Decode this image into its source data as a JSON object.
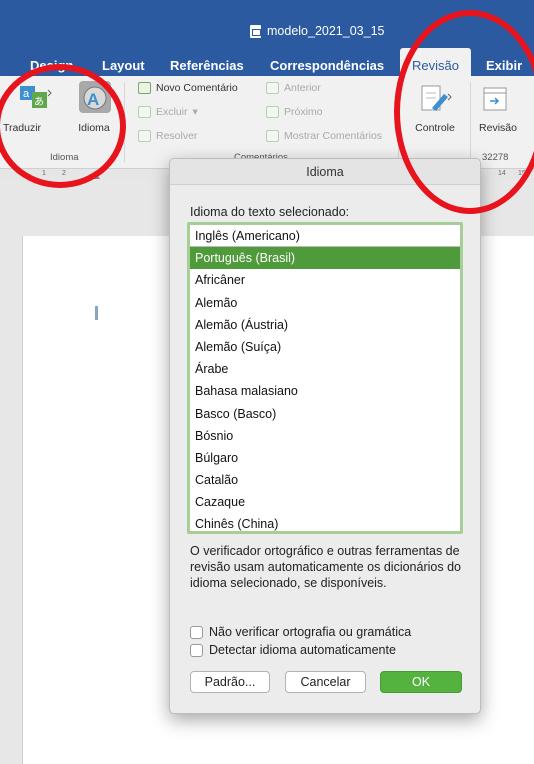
{
  "window": {
    "title": "modelo_2021_03_15"
  },
  "tabs": [
    {
      "label": "Design"
    },
    {
      "label": "Layout"
    },
    {
      "label": "Referências"
    },
    {
      "label": "Correspondências"
    },
    {
      "label": "Revisão"
    },
    {
      "label": "Exibir"
    }
  ],
  "ribbon": {
    "translate_label": "Traduzir",
    "language_label": "Idioma",
    "language_group": "Idioma",
    "new_comment": "Novo Comentário",
    "delete": "Excluir",
    "resolve": "Resolver",
    "previous": "Anterior",
    "next": "Próximo",
    "show_comments": "Mostrar Comentários",
    "comments_group": "Comentários",
    "track_changes": "Controle",
    "revision": "Revisão",
    "word_count": "32278"
  },
  "ruler": {
    "ticks": [
      "1",
      "2",
      "14",
      "15"
    ]
  },
  "dialog": {
    "title": "Idioma",
    "prompt": "Idioma do texto selecionado:",
    "languages": [
      "Inglês (Americano)",
      "Português (Brasil)",
      "Africâner",
      "Alemão",
      "Alemão (Áustria)",
      "Alemão (Suíça)",
      "Árabe",
      "Bahasa malasiano",
      "Basco (Basco)",
      "Bósnio",
      "Búlgaro",
      "Catalão",
      "Cazaque",
      "Chinês (China)"
    ],
    "selected_language": "Português (Brasil)",
    "info_text": "O verificador ortográfico e outras ferramentas de revisão usam automaticamente os dicionários do idioma selecionado, se disponíveis.",
    "no_check_label": "Não verificar ortografia ou gramática",
    "detect_label": "Detectar idioma automaticamente",
    "default_button": "Padrão...",
    "cancel_button": "Cancelar",
    "ok_button": "OK"
  },
  "colors": {
    "ribbon_blue": "#2c5aa0",
    "selection_green": "#4f9b3b",
    "ok_green": "#54b23e",
    "highlight_circle": "#e8141d"
  }
}
